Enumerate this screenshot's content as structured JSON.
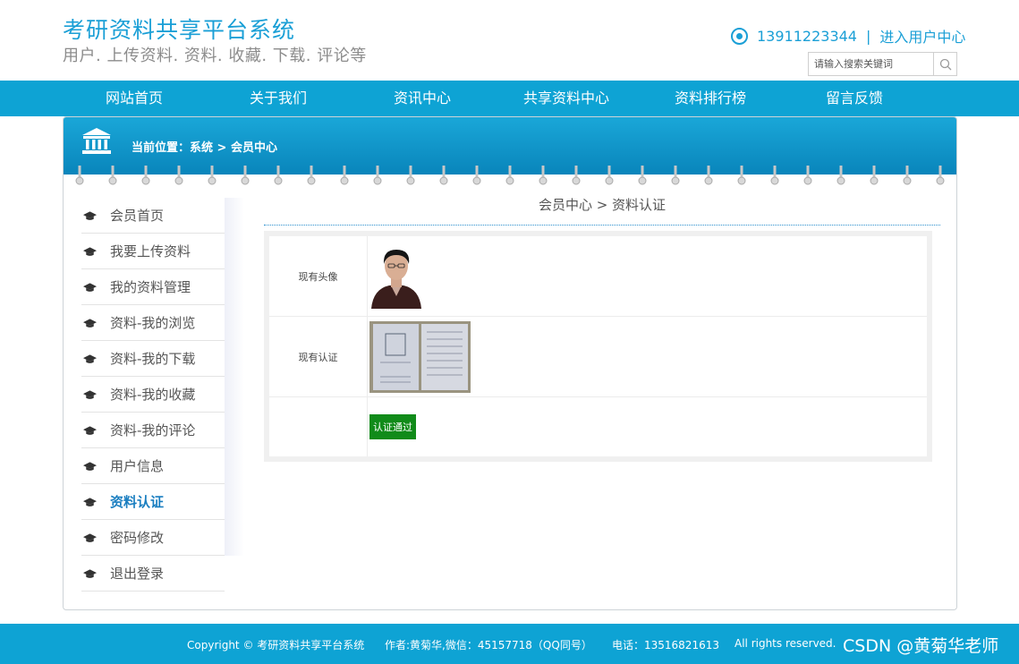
{
  "header": {
    "site_title": "考研资料共享平台系统",
    "site_subtitle": "用户. 上传资料. 资料. 收藏. 下载. 评论等",
    "phone": "13911223344",
    "separator": "|",
    "user_center_link": "进入用户中心",
    "search_placeholder": "请输入搜索关键词"
  },
  "nav": {
    "items": [
      "网站首页",
      "关于我们",
      "资讯中心",
      "共享资料中心",
      "资料排行榜",
      "留言反馈"
    ]
  },
  "banner": {
    "breadcrumb": "当前位置：系统 > 会员中心"
  },
  "sidebar": {
    "items": [
      "会员首页",
      "我要上传资料",
      "我的资料管理",
      "资料-我的浏览",
      "资料-我的下载",
      "资料-我的收藏",
      "资料-我的评论",
      "用户信息",
      "资料认证",
      "密码修改",
      "退出登录"
    ],
    "active_index": 8
  },
  "content": {
    "title": "会员中心 > 资料认证",
    "avatar_label": "现有头像",
    "cert_label": "现有认证",
    "status": "认证通过"
  },
  "footer": {
    "copyright": "Copyright © 考研资料共享平台系统",
    "author": "作者:黄菊华,微信：45157718（QQ同号）",
    "phone": "电话：13516821613",
    "rights": "All rights reserved."
  },
  "watermark": "CSDN @黄菊华老师",
  "colors": {
    "brand": "#0ea3d4",
    "title": "#1a9fd6",
    "active": "#1a7ec0",
    "status": "#118b1a"
  }
}
